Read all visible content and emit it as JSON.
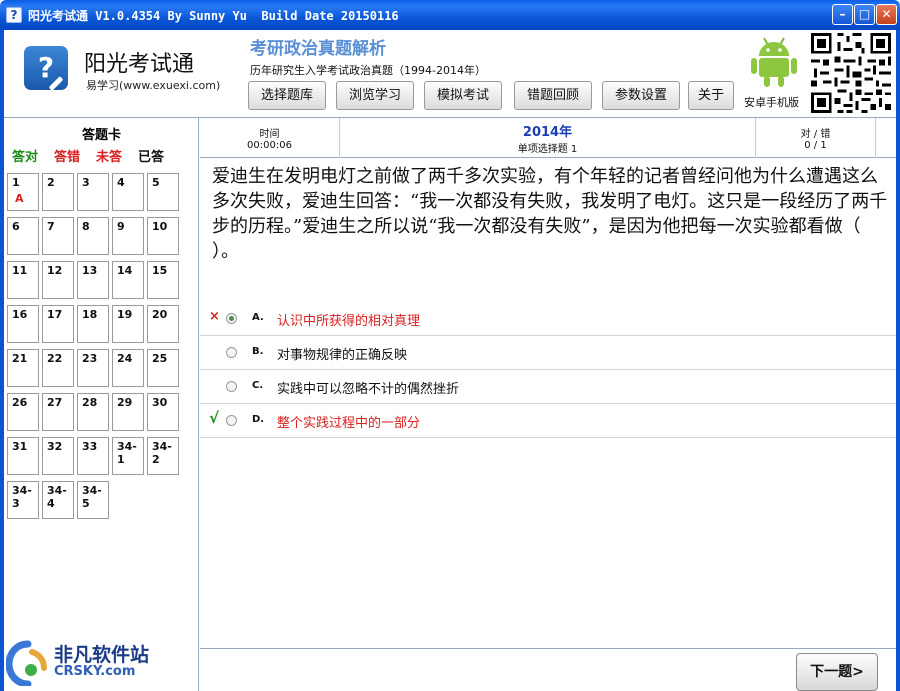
{
  "window": {
    "title": "阳光考试通 V1.0.4354 By Sunny Yu  Build Date 20150116",
    "min_glyph": "–",
    "max_glyph": "□",
    "close_glyph": "✕"
  },
  "header": {
    "logo_glyph": "?",
    "app_name": "阳光考试通",
    "app_site": "易学习(www.exuexi.com)",
    "exam_title": "考研政治真题解析",
    "exam_subtitle": "历年研究生入学考试政治真题（1994-2014年）",
    "android_label": "安卓手机版",
    "nav": [
      "选择题库",
      "浏览学习",
      "模拟考试",
      "错题回顾",
      "参数设置",
      "关于"
    ]
  },
  "answer_card": {
    "title": "答题卡",
    "legend": {
      "correct": "答对",
      "wrong": "答错",
      "unanswered": "未答",
      "answered": "已答"
    },
    "cells": [
      {
        "num": "1",
        "ans": "A"
      },
      {
        "num": "2",
        "ans": ""
      },
      {
        "num": "3",
        "ans": ""
      },
      {
        "num": "4",
        "ans": ""
      },
      {
        "num": "5",
        "ans": ""
      },
      {
        "num": "6",
        "ans": ""
      },
      {
        "num": "7",
        "ans": ""
      },
      {
        "num": "8",
        "ans": ""
      },
      {
        "num": "9",
        "ans": ""
      },
      {
        "num": "10",
        "ans": ""
      },
      {
        "num": "11",
        "ans": ""
      },
      {
        "num": "12",
        "ans": ""
      },
      {
        "num": "13",
        "ans": ""
      },
      {
        "num": "14",
        "ans": ""
      },
      {
        "num": "15",
        "ans": ""
      },
      {
        "num": "16",
        "ans": ""
      },
      {
        "num": "17",
        "ans": ""
      },
      {
        "num": "18",
        "ans": ""
      },
      {
        "num": "19",
        "ans": ""
      },
      {
        "num": "20",
        "ans": ""
      },
      {
        "num": "21",
        "ans": ""
      },
      {
        "num": "22",
        "ans": ""
      },
      {
        "num": "23",
        "ans": ""
      },
      {
        "num": "24",
        "ans": ""
      },
      {
        "num": "25",
        "ans": ""
      },
      {
        "num": "26",
        "ans": ""
      },
      {
        "num": "27",
        "ans": ""
      },
      {
        "num": "28",
        "ans": ""
      },
      {
        "num": "29",
        "ans": ""
      },
      {
        "num": "30",
        "ans": ""
      },
      {
        "num": "31",
        "ans": ""
      },
      {
        "num": "32",
        "ans": ""
      },
      {
        "num": "33",
        "ans": ""
      },
      {
        "num": "34-1",
        "ans": ""
      },
      {
        "num": "34-2",
        "ans": ""
      },
      {
        "num": "34-3",
        "ans": ""
      },
      {
        "num": "34-4",
        "ans": ""
      },
      {
        "num": "34-5",
        "ans": ""
      }
    ]
  },
  "info": {
    "time_label": "时间",
    "time_value": "00:00:06",
    "year": "2014年",
    "question_type": "单项选择题 1",
    "score_label": "对 / 错",
    "score_value": "0 / 1"
  },
  "question": {
    "text": "爱迪生在发明电灯之前做了两千多次实验，有个年轻的记者曾经问他为什么遭遇这么多次失败，爱迪生回答：“我一次都没有失败，我发明了电灯。这只是一段经历了两千步的历程。”爱迪生之所以说“我一次都没有失败”，是因为他把每一次实验都看做（ ）。",
    "options": [
      {
        "letter": "A.",
        "text": "认识中所获得的相对真理",
        "mark": "×",
        "state": "wrong",
        "selected": true
      },
      {
        "letter": "B.",
        "text": "对事物规律的正确反映",
        "mark": "",
        "state": "normal",
        "selected": false
      },
      {
        "letter": "C.",
        "text": "实践中可以忽略不计的偶然挫折",
        "mark": "",
        "state": "normal",
        "selected": false
      },
      {
        "letter": "D.",
        "text": "整个实践过程中的一部分",
        "mark": "√",
        "state": "correct",
        "selected": false
      }
    ]
  },
  "footer": {
    "next_label": "下一题>"
  },
  "watermark": {
    "text": "非凡软件站",
    "url": "CRSKY.com"
  }
}
